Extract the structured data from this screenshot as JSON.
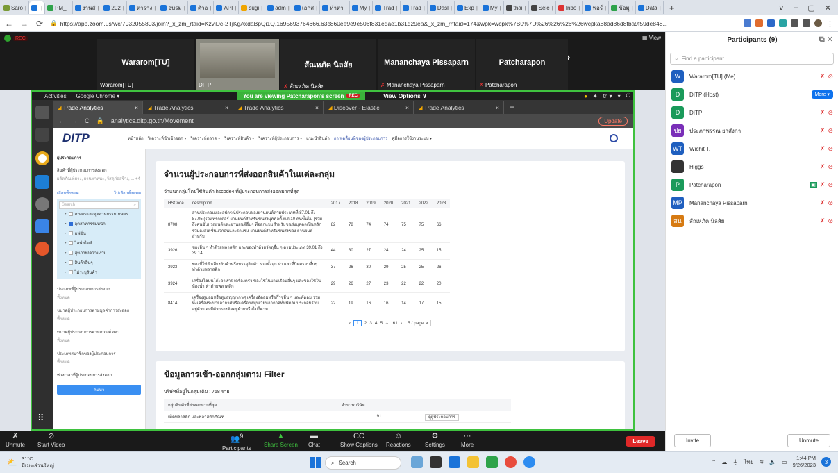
{
  "browser": {
    "tabs": [
      "Saro",
      "",
      "PM_",
      "งานส่",
      "202",
      "ตาราง",
      "อบรม",
      "ตัวอ",
      "API",
      "sugi",
      "adm",
      "เอกส",
      "ทำตา",
      "My",
      "Trad",
      "Trad",
      "Dasl",
      "Exp",
      "My",
      "thai",
      "Sele",
      "Inbo",
      "ฟอร์",
      "ข้อมู",
      "Data"
    ],
    "url": "https://app.zoom.us/wc/7932055803/join?_x_zm_rtaid=KzviDc-2TjKgAxdaBpQi1Q.1695693764666.63c860ee9e9e506f831edae1b31d29ea&_x_zm_rhtaid=174&wpk=wcpk%7B0%7D%26%26%26%26wcpka88ad86d8fba9f59de848...",
    "window_controls": [
      "∨",
      "–",
      "▢",
      "✕"
    ]
  },
  "zoom": {
    "rec_label": "REC",
    "view_label": "View",
    "video_tiles": [
      {
        "name": "Wararom[TU]",
        "label": "Wararom[TU]",
        "muted": false
      },
      {
        "name": "",
        "label": "DITP",
        "muted": false
      },
      {
        "name": "สัณหภัค นิลสัย",
        "label": "สัณหภัค นิลสัย",
        "muted": true
      },
      {
        "name": "Mananchaya Pissaparn",
        "label": "Mananchaya Pissaparn",
        "muted": true
      },
      {
        "name": "Patcharapon",
        "label": "Patcharapon",
        "muted": true
      }
    ],
    "next_arrow": "›",
    "controls": [
      {
        "label": "Unmute",
        "icon": "mic-muted"
      },
      {
        "label": "Start Video",
        "icon": "video-off"
      },
      {
        "label": "Participants",
        "icon": "people",
        "badge": "9"
      },
      {
        "label": "Share Screen",
        "icon": "share"
      },
      {
        "label": "Chat",
        "icon": "chat"
      },
      {
        "label": "Show Captions",
        "icon": "cc"
      },
      {
        "label": "Reactions",
        "icon": "smile"
      },
      {
        "label": "Settings",
        "icon": "gear"
      },
      {
        "label": "More",
        "icon": "ellipsis"
      }
    ],
    "leave_label": "Leave"
  },
  "shared": {
    "activities": "Activities",
    "app": "Google Chrome ▾",
    "viewing": "You are viewing Patcharapon's screen",
    "viewing_rec": "REC",
    "view_options": "View Options ∨",
    "right_status": "th ▾",
    "tabs": [
      "Trade Analytics",
      "Trade Analytics",
      "Trade Analytics",
      "Discover - Elastic",
      "Trade Analytics"
    ],
    "url": "analytics.ditp.go.th/Movement",
    "update_label": "Update",
    "site": {
      "logo": "DITP",
      "nav": [
        "หน้าหลัก",
        "วิเคราะห์นำเข้าออก ▾",
        "วิเคราะห์ตลาด ▾",
        "วิเคราะห์สินค้า ▾",
        "วิเคราะห์ผู้ประกอบการ ▾",
        "แนะนำสินค้า",
        "การเคลื่อนที่ของผู้ประกอบการ",
        "คู่มือการใช้งานระบบ ▾"
      ],
      "sidebar": {
        "title": "ผู้ประกอบการ",
        "group_title": "สินค้าที่ผู้ประกอบการส่งออก",
        "group_hint": "ผลิตภัณฑ์ยาง, ยานพาหนะ, วัสดุก่อสร้าง, ... +4",
        "select_all": "เลือกทั้งหมด",
        "clear_all": "ไม่เลือกทั้งหมด",
        "search_placeholder": "Search",
        "items": [
          {
            "label": "เกษตรและอุตสาหกรรมเกษตร",
            "checked": false
          },
          {
            "label": "อุตสาหกรรมหนัก",
            "checked": true
          },
          {
            "label": "แฟชั่น",
            "checked": false
          },
          {
            "label": "ไลฟ์สไตล์",
            "checked": false
          },
          {
            "label": "สุขภาพ/ความงาม",
            "checked": false
          },
          {
            "label": "สินค้าอื่นๆ",
            "checked": false
          },
          {
            "label": "ไม่ระบุสินค้า",
            "checked": false
          }
        ],
        "sections": [
          {
            "title": "ประเภทที่ผู้ประกอบการส่งออก",
            "hint": "ทั้งหมด"
          },
          {
            "title": "ขนาดผู้ประกอบการตามมูลค่าการส่งออก",
            "hint": "ทั้งหมด"
          },
          {
            "title": "ขนาดผู้ประกอบการตามเกณฑ์ สสว.",
            "hint": "ทั้งหมด"
          },
          {
            "title": "ประเภทสมาชิกของผู้ประกอบการ",
            "hint": "ทั้งหมด"
          },
          {
            "title": "ช่วงเวลาที่ผู้ประกอบการส่งออก",
            "hint": ""
          }
        ],
        "search_button": "ค้นหา"
      },
      "card1": {
        "title": "จำนวนผู้ประกอบการที่ส่งออกสินค้าในแต่ละกลุ่ม",
        "subtitle": "จำแนกกลุ่มโดยใช้สินค้า hscode4 ที่ผู้ประกอบการส่งออกมากที่สุด",
        "columns": [
          "HSCode",
          "description",
          "2017",
          "2018",
          "2019",
          "2020",
          "2021",
          "2022",
          "2023"
        ],
        "rows": [
          [
            "8708",
            "ส่วนประกอบและอุปกรณ์ประกอบของยานยนต์ตามประเภทที่ 87.01 ถึง 87.05 (รถแทรกเตอร์ ยานยนต์สำหรับขนส่งบุคคลตั้งแต่ 10 คนขึ้นไป (รวมถึงคนขับ) รถยนต์และยานยนต์อื่นๆ ที่ออกแบบสำหรับขนส่งบุคคลเป็นหลัก รวมถึงสเตชั่นแวกอนและรถแข่ง ยานยนต์สำหรับขนส่งของ ยานยนต์สำหรับ",
            "82",
            "78",
            "74",
            "74",
            "75",
            "75",
            "66"
          ],
          [
            "3926",
            "ของอื่น ๆ ทำด้วยพลาสติก และของทำด้วยวัตถุอื่น ๆ ตามประเภท 39.01 ถึง 39.14",
            "44",
            "30",
            "27",
            "24",
            "24",
            "25",
            "15"
          ],
          [
            "3923",
            "ของที่ใช้ลำเลียงสินค้าหรือบรรจุสินค้า รวมทั้งจุก ฝา และที่ปิดครอบอื่นๆ ทำด้วยพลาสติก",
            "37",
            "26",
            "30",
            "29",
            "25",
            "25",
            "26"
          ],
          [
            "3924",
            "เครื่องใช้บนโต๊ะอาหาร เครื่องครัว ของใช้ในบ้านเรือนอื่นๆ และของใช้ในห้องน้ำ ทำด้วยพลาสติก",
            "29",
            "26",
            "27",
            "23",
            "22",
            "22",
            "20"
          ],
          [
            "8414",
            "เครื่องสูบลมหรือสูบสุญญากาศ เครื่องอัดลมหรือก๊าซอื่น ๆ และพัดลม รวมทั้งเครื่องระบายอากาศหรือเครื่องหมุนเวียนอากาศที่มีพัดลมประกอบร่วมอยู่ด้วย จะมีตัวกรองติดอยู่ด้วยหรือไม่ก็ตาม",
            "22",
            "19",
            "16",
            "16",
            "14",
            "17",
            "15"
          ]
        ],
        "pager": [
          "‹",
          "1",
          "2",
          "3",
          "4",
          "5",
          "···",
          "61",
          "›",
          "5 / page ∨"
        ]
      },
      "card2": {
        "title": "ข้อมูลการเข้า-ออกกลุ่มตาม Filter",
        "subtitle": "บริษัทที่อยู่ในกลุ่มเดิม : 758 ราย",
        "columns": [
          "กลุ่มสินค้าที่ส่งออกมากที่สุด",
          "จำนวนบริษัท"
        ],
        "row": [
          "เม็ดพลาสติก และพลาสติกภัณฑ์",
          "91"
        ],
        "row_button": "ดูผู้ประกอบการ"
      }
    }
  },
  "participants": {
    "title": "Participants (9)",
    "search_placeholder": "Find a participant",
    "list": [
      {
        "initials": "W",
        "name": "Wararom[TU] (Me)",
        "color": "#1f5fbf",
        "more": false,
        "video_on": false
      },
      {
        "initials": "D",
        "name": "DITP (Host)",
        "color": "#1a9a5a",
        "more": true,
        "video_on": false
      },
      {
        "initials": "D",
        "name": "DITP",
        "color": "#1a9a5a",
        "more": false,
        "video_on": false
      },
      {
        "initials": "ปย",
        "name": "ประภาพรรณ ยาสังกา",
        "color": "#7a2fb8",
        "more": false,
        "video_on": false
      },
      {
        "initials": "WT",
        "name": "Wichit T.",
        "color": "#1f5fbf",
        "more": false,
        "video_on": false
      },
      {
        "initials": "",
        "name": "Higgs",
        "color": "#333333",
        "more": false,
        "video_on": false
      },
      {
        "initials": "P",
        "name": "Patcharapon",
        "color": "#1a9a5a",
        "more": false,
        "video_on": true
      },
      {
        "initials": "MP",
        "name": "Mananchaya Pissaparn",
        "color": "#1f5fbf",
        "more": false,
        "video_on": false
      },
      {
        "initials": "สน",
        "name": "สัณหภัค นิลสัย",
        "color": "#d67a12",
        "more": false,
        "video_on": false
      }
    ],
    "more_label": "More ▾",
    "invite_label": "Invite",
    "unmute_label": "Unmute"
  },
  "taskbar": {
    "temperature": "31°C",
    "weather": "มีเมฆส่วนใหญ่",
    "search": "Search",
    "time": "1:44 PM",
    "date": "9/26/2023",
    "lang": "ไทย"
  }
}
